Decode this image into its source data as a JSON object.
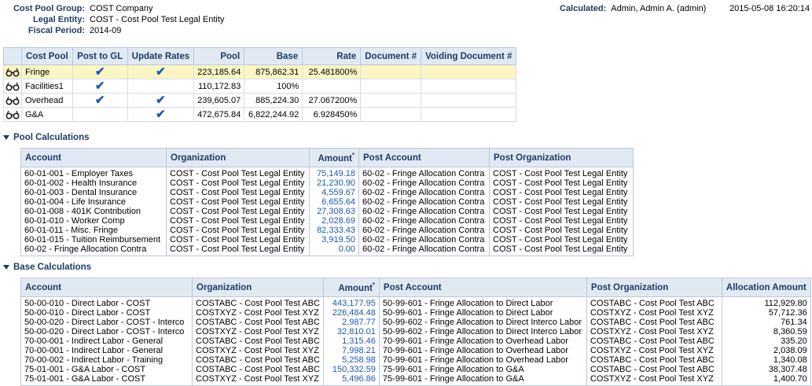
{
  "header": {
    "cost_pool_group_label": "Cost Pool Group:",
    "cost_pool_group_value": "COST Company",
    "legal_entity_label": "Legal Entity:",
    "legal_entity_value": "COST - Cost Pool Test Legal Entity",
    "fiscal_period_label": "Fiscal Period:",
    "fiscal_period_value": "2014-09",
    "calculated_label": "Calculated:",
    "calculated_value": "Admin, Admin A. (admin)",
    "timestamp": "2015-05-08 16:20:14"
  },
  "summary": {
    "columns": [
      "Cost Pool",
      "Post to GL",
      "Update Rates",
      "Pool",
      "Base",
      "Rate",
      "Document #",
      "Voiding Document #"
    ],
    "rows": [
      {
        "name": "Fringe",
        "post_to_gl": true,
        "update_rates": true,
        "pool": "223,185.64",
        "base": "875,862.31",
        "rate": "25.481800%",
        "document": "",
        "voiding": "",
        "selected": true
      },
      {
        "name": "Facilities1",
        "post_to_gl": true,
        "update_rates": false,
        "pool": "110,172.83",
        "base": "100%",
        "rate": "",
        "document": "",
        "voiding": "",
        "selected": false
      },
      {
        "name": "Overhead",
        "post_to_gl": true,
        "update_rates": true,
        "pool": "239,605.07",
        "base": "885,224.30",
        "rate": "27.067200%",
        "document": "",
        "voiding": "",
        "selected": false
      },
      {
        "name": "G&A",
        "post_to_gl": false,
        "update_rates": true,
        "pool": "472,675.84",
        "base": "6,822,244.92",
        "rate": "6.928450%",
        "document": "",
        "voiding": "",
        "selected": false
      }
    ],
    "icon": "glasses-icon",
    "check_glyph": "✔"
  },
  "pool_calc": {
    "title": "Pool Calculations",
    "columns": [
      "Account",
      "Organization",
      "Amount",
      "Post Account",
      "Post Organization"
    ],
    "amount_marker": "*",
    "rows": [
      [
        "60-01-001 - Employer Taxes",
        "COST - Cost Pool Test Legal Entity",
        "75,149.18",
        "60-02 - Fringe Allocation Contra",
        "COST - Cost Pool Test Legal Entity"
      ],
      [
        "60-01-002 - Health Insurance",
        "COST - Cost Pool Test Legal Entity",
        "21,230.90",
        "60-02 - Fringe Allocation Contra",
        "COST - Cost Pool Test Legal Entity"
      ],
      [
        "60-01-003 - Dental Insurance",
        "COST - Cost Pool Test Legal Entity",
        "4,559.67",
        "60-02 - Fringe Allocation Contra",
        "COST - Cost Pool Test Legal Entity"
      ],
      [
        "60-01-004 - Life Insurance",
        "COST - Cost Pool Test Legal Entity",
        "6,655.64",
        "60-02 - Fringe Allocation Contra",
        "COST - Cost Pool Test Legal Entity"
      ],
      [
        "60-01-008 - 401K Contribution",
        "COST - Cost Pool Test Legal Entity",
        "27,308.63",
        "60-02 - Fringe Allocation Contra",
        "COST - Cost Pool Test Legal Entity"
      ],
      [
        "60-01-010 - Worker Comp",
        "COST - Cost Pool Test Legal Entity",
        "2,028.69",
        "60-02 - Fringe Allocation Contra",
        "COST - Cost Pool Test Legal Entity"
      ],
      [
        "60-01-011 - Misc. Fringe",
        "COST - Cost Pool Test Legal Entity",
        "82,333.43",
        "60-02 - Fringe Allocation Contra",
        "COST - Cost Pool Test Legal Entity"
      ],
      [
        "60-01-015 - Tuition Reimbursement",
        "COST - Cost Pool Test Legal Entity",
        "3,919.50",
        "60-02 - Fringe Allocation Contra",
        "COST - Cost Pool Test Legal Entity"
      ],
      [
        "60-02 - Fringe Allocation Contra",
        "COST - Cost Pool Test Legal Entity",
        "0.00",
        "60-02 - Fringe Allocation Contra",
        "COST - Cost Pool Test Legal Entity"
      ]
    ]
  },
  "base_calc": {
    "title": "Base Calculations",
    "columns": [
      "Account",
      "Organization",
      "Amount",
      "Post Account",
      "Post Organization",
      "Allocation Amount"
    ],
    "amount_marker": "*",
    "rows": [
      [
        "50-00-010 - Direct Labor - COST",
        "COSTABC - Cost Pool Test ABC",
        "443,177.95",
        "50-99-601 - Fringe Allocation to Direct Labor",
        "COSTABC - Cost Pool Test ABC",
        "112,929.80"
      ],
      [
        "50-00-010 - Direct Labor - COST",
        "COSTXYZ - Cost Pool Test XYZ",
        "226,484.48",
        "50-99-601 - Fringe Allocation to Direct Labor",
        "COSTXYZ - Cost Pool Test XYZ",
        "57,712.36"
      ],
      [
        "50-00-020 - Direct Labor - COST - Interco",
        "COSTABC - Cost Pool Test ABC",
        "2,987.77",
        "50-99-602 - Fringe Allocation to Direct Interco Labor",
        "COSTABC - Cost Pool Test ABC",
        "761.34"
      ],
      [
        "50-00-020 - Direct Labor - COST - Interco",
        "COSTXYZ - Cost Pool Test XYZ",
        "32,810.01",
        "50-99-602 - Fringe Allocation to Direct Interco Labor",
        "COSTXYZ - Cost Pool Test XYZ",
        "8,360.59"
      ],
      [
        "70-00-001 - Indirect Labor - General",
        "COSTABC - Cost Pool Test ABC",
        "1,315.46",
        "70-99-601 - Fringe Allocation to Overhead Labor",
        "COSTABC - Cost Pool Test ABC",
        "335.20"
      ],
      [
        "70-00-001 - Indirect Labor - General",
        "COSTXYZ - Cost Pool Test XYZ",
        "7,998.21",
        "70-99-601 - Fringe Allocation to Overhead Labor",
        "COSTXYZ - Cost Pool Test XYZ",
        "2,038.09"
      ],
      [
        "70-00-002 - Indirect Labor - Training",
        "COSTABC - Cost Pool Test ABC",
        "5,258.98",
        "70-99-601 - Fringe Allocation to Overhead Labor",
        "COSTABC - Cost Pool Test ABC",
        "1,340.08"
      ],
      [
        "75-01-001 - G&A Labor - COST",
        "COSTABC - Cost Pool Test ABC",
        "150,332.59",
        "75-99-601 - Fringe Allocation to G&A",
        "COSTABC - Cost Pool Test ABC",
        "38,307.48"
      ],
      [
        "75-01-001 - G&A Labor - COST",
        "COSTXYZ - Cost Pool Test XYZ",
        "5,496.86",
        "75-99-601 - Fringe Allocation to G&A",
        "COSTXYZ - Cost Pool Test XYZ",
        "1,400.70"
      ]
    ]
  }
}
